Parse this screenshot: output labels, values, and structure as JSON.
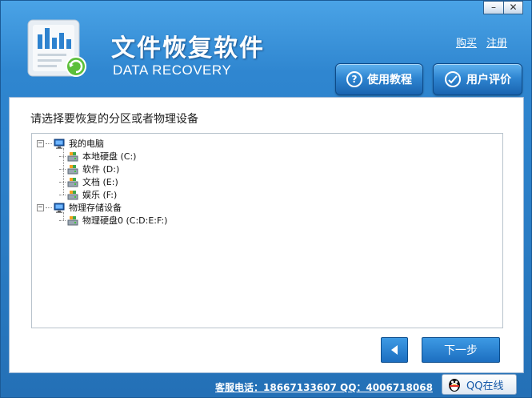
{
  "window": {
    "minimize_label": "–",
    "close_label": "✕"
  },
  "header": {
    "title": "文件恢复软件",
    "subtitle": "DATA RECOVERY",
    "links": {
      "buy": "购买",
      "register": "注册"
    },
    "buttons": {
      "tutorial": "使用教程",
      "review": "用户评价"
    },
    "tutorial_icon": "?"
  },
  "main": {
    "prompt": "请选择要恢复的分区或者物理设备",
    "tree": {
      "computer": {
        "label": "我的电脑",
        "expander": "−",
        "children": [
          {
            "label": "本地硬盘 (C:)"
          },
          {
            "label": "软件 (D:)"
          },
          {
            "label": "文档 (E:)"
          },
          {
            "label": "娱乐 (F:)"
          }
        ]
      },
      "physical": {
        "label": "物理存储设备",
        "expander": "−",
        "children": [
          {
            "label": "物理硬盘0 (C:D:E:F:)"
          }
        ]
      }
    },
    "next_label": "下一步"
  },
  "footer": {
    "contact": "客服电话：18667133607 QQ：4006718068",
    "qq_label": "QQ在线"
  },
  "colors": {
    "accent": "#2f86d0",
    "panel": "#ffffff"
  },
  "icons": {
    "logo": "chart-document-recovery-icon",
    "tutorial": "question-circle-icon",
    "review": "review-badge-icon",
    "back": "arrow-left-icon",
    "qq": "qq-penguin-icon"
  }
}
